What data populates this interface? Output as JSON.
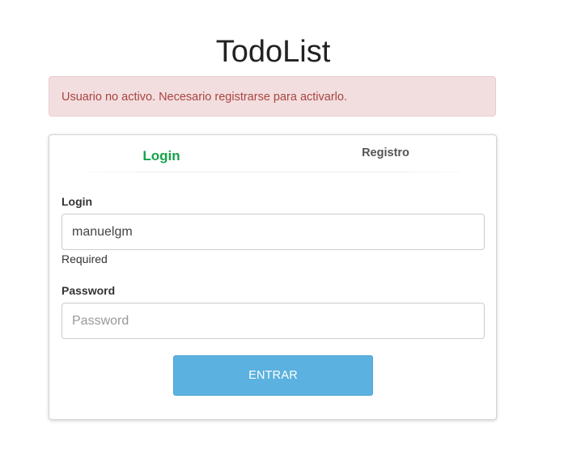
{
  "app": {
    "title": "TodoList"
  },
  "alert": {
    "message": "Usuario no activo. Necesario registrarse para activarlo."
  },
  "tabs": [
    {
      "label": "Login",
      "active": true
    },
    {
      "label": "Registro",
      "active": false
    }
  ],
  "form": {
    "login": {
      "label": "Login",
      "value": "manuelgm",
      "help": "Required"
    },
    "password": {
      "label": "Password",
      "value": "",
      "placeholder": "Password"
    },
    "submit_label": "ENTRAR"
  },
  "colors": {
    "alert_bg": "#f2dede",
    "alert_text": "#a94442",
    "active_tab": "#16a34a",
    "button": "#5bb1df"
  }
}
